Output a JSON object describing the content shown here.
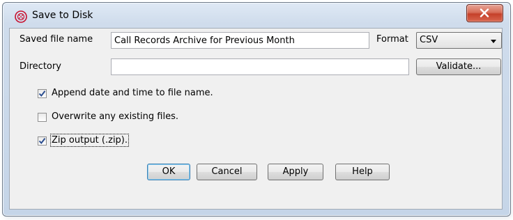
{
  "window": {
    "title": "Save to Disk",
    "close_symbol": "x"
  },
  "form": {
    "file_name_label": "Saved file name",
    "file_name_value": "Call Records Archive for Previous Month",
    "format_label": "Format",
    "format_value": "CSV",
    "directory_label": "Directory",
    "directory_value": "",
    "validate_label": "Validate..."
  },
  "options": [
    {
      "label": "Append date and time to file name.",
      "checked": true
    },
    {
      "label": "Overwrite any existing files.",
      "checked": false
    },
    {
      "label": "Zip output (.zip).",
      "checked": true
    }
  ],
  "buttons": {
    "ok": "OK",
    "cancel": "Cancel",
    "apply": "Apply",
    "help": "Help"
  },
  "colors": {
    "accent_icon": "#c8102e",
    "check_mark": "#2a4d8f"
  },
  "icons": {
    "app": "phone-globe-icon",
    "close": "close-icon",
    "dropdown": "chevron-down-icon",
    "check": "checkmark-icon"
  }
}
